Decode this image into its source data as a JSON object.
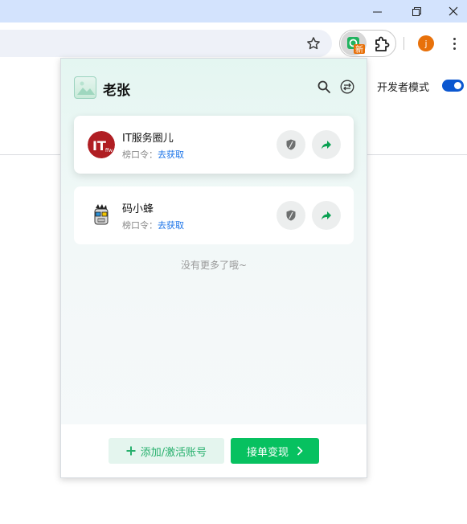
{
  "browser": {
    "developer_mode_label": "开发者模式",
    "profile_initial": "j",
    "extension_badge": "新"
  },
  "popup": {
    "user_name": "老张",
    "accounts": [
      {
        "name": "IT服务圈儿",
        "code_label": "榜口令：",
        "code_link": "去获取"
      },
      {
        "name": "码小蜂",
        "code_label": "榜口令：",
        "code_link": "去获取"
      }
    ],
    "no_more_text": "没有更多了哦~",
    "add_button_label": "添加/激活账号",
    "earn_button_label": "接单变现"
  },
  "colors": {
    "brand_green": "#07c160",
    "link_blue": "#1a73e8",
    "toggle_blue": "#0b57d0"
  }
}
